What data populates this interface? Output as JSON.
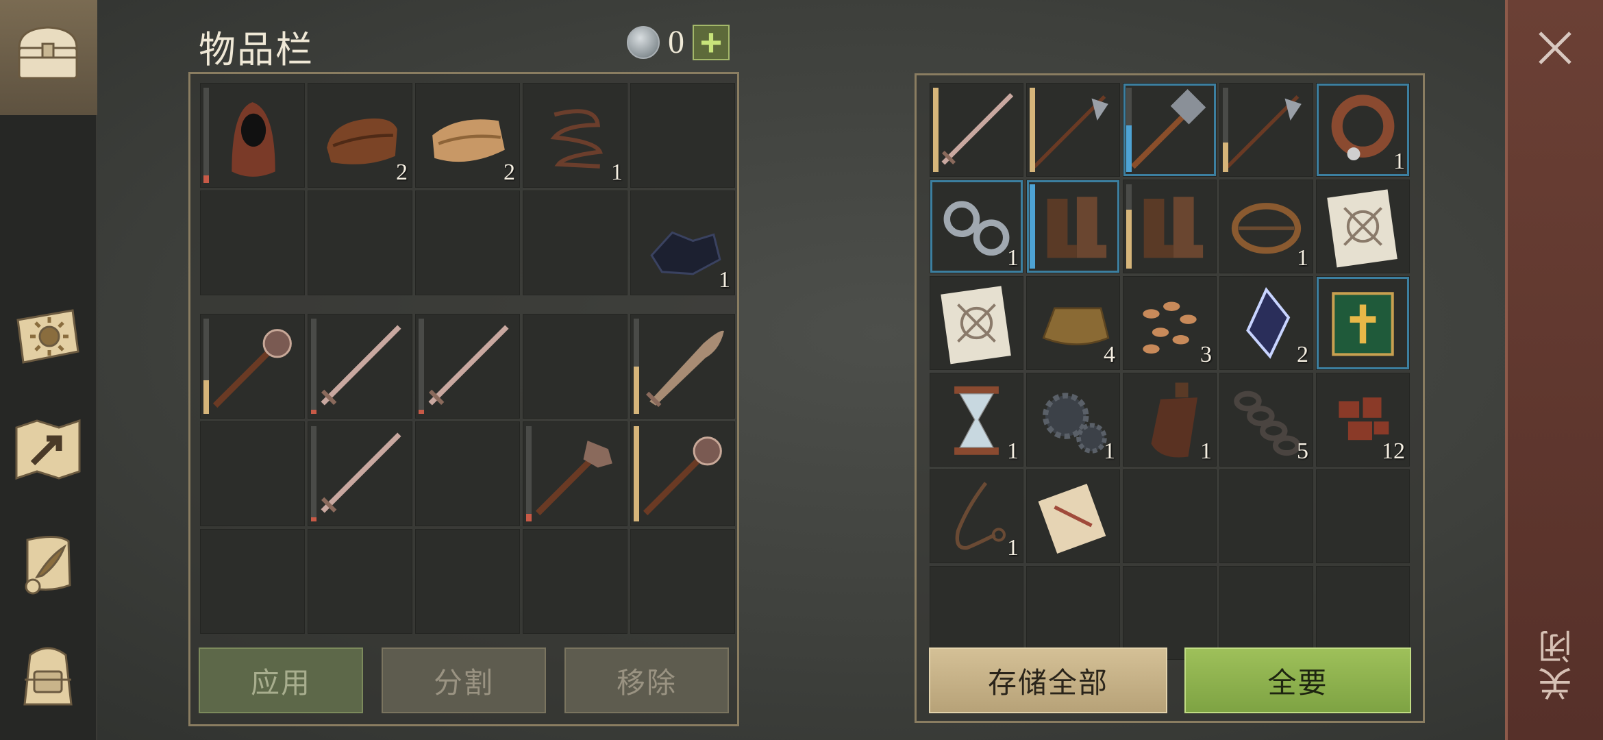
{
  "inventory": {
    "title": "物品栏",
    "currency": {
      "amount": "0",
      "add_label": "+"
    },
    "bag_slots": [
      {
        "icon": "hood-icon",
        "count": "",
        "durability": 0.08,
        "dur_color": "low"
      },
      {
        "icon": "leather-icon",
        "count": "2"
      },
      {
        "icon": "cloth-icon",
        "count": "2"
      },
      {
        "icon": "rope-icon",
        "count": "1"
      },
      {
        "icon": "empty",
        "count": ""
      },
      {
        "icon": "empty",
        "count": ""
      },
      {
        "icon": "empty",
        "count": ""
      },
      {
        "icon": "empty",
        "count": ""
      },
      {
        "icon": "empty",
        "count": ""
      },
      {
        "icon": "coal-icon",
        "count": "1"
      }
    ],
    "weapon_slots": [
      {
        "icon": "mace-icon",
        "count": "",
        "durability": 0.35
      },
      {
        "icon": "sword-icon",
        "count": "",
        "durability": 0.04,
        "dur_color": "low"
      },
      {
        "icon": "sword-icon",
        "count": "",
        "durability": 0.04,
        "dur_color": "low"
      },
      {
        "icon": "empty",
        "count": ""
      },
      {
        "icon": "falchion-icon",
        "count": "",
        "durability": 0.5
      },
      {
        "icon": "empty",
        "count": ""
      },
      {
        "icon": "sword-icon",
        "count": "",
        "durability": 0.04,
        "dur_color": "low"
      },
      {
        "icon": "empty",
        "count": ""
      },
      {
        "icon": "spiked-club-icon",
        "count": "",
        "durability": 0.08,
        "dur_color": "low"
      },
      {
        "icon": "mace-icon",
        "count": "",
        "durability": 1.0
      },
      {
        "icon": "empty",
        "count": ""
      },
      {
        "icon": "empty",
        "count": ""
      },
      {
        "icon": "empty",
        "count": ""
      },
      {
        "icon": "empty",
        "count": ""
      },
      {
        "icon": "empty",
        "count": ""
      }
    ],
    "buttons": {
      "apply": "应用",
      "split": "分割",
      "remove": "移除"
    }
  },
  "storage": {
    "slots": [
      {
        "icon": "sword-icon",
        "count": "",
        "durability": 1.0
      },
      {
        "icon": "halberd-icon",
        "count": "",
        "durability": 1.0
      },
      {
        "icon": "hammer-icon",
        "count": "",
        "durability": 0.55,
        "dur_color": "blue",
        "rare": true
      },
      {
        "icon": "halberd-icon",
        "count": "",
        "durability": 0.35
      },
      {
        "icon": "collar-icon",
        "count": "1",
        "rare": true
      },
      {
        "icon": "shackles-icon",
        "count": "1",
        "rare": true
      },
      {
        "icon": "boots-icon",
        "count": "",
        "durability": 1.0,
        "dur_color": "blue",
        "rare": true
      },
      {
        "icon": "boots-icon",
        "count": "",
        "durability": 0.7
      },
      {
        "icon": "bear-trap-icon",
        "count": "1"
      },
      {
        "icon": "blueprint-icon",
        "count": ""
      },
      {
        "icon": "blueprint-icon",
        "count": ""
      },
      {
        "icon": "ingot-icon",
        "count": "4"
      },
      {
        "icon": "seeds-icon",
        "count": "3"
      },
      {
        "icon": "crystal-icon",
        "count": "2"
      },
      {
        "icon": "book-icon",
        "count": "",
        "rare": true
      },
      {
        "icon": "hourglass-icon",
        "count": "1"
      },
      {
        "icon": "gears-icon",
        "count": "1"
      },
      {
        "icon": "flask-icon",
        "count": "1"
      },
      {
        "icon": "chain-icon",
        "count": "5"
      },
      {
        "icon": "scrap-icon",
        "count": "12"
      },
      {
        "icon": "lasso-icon",
        "count": "1"
      },
      {
        "icon": "scroll-icon",
        "count": ""
      },
      {
        "icon": "empty",
        "count": ""
      },
      {
        "icon": "empty",
        "count": ""
      },
      {
        "icon": "empty",
        "count": ""
      },
      {
        "icon": "empty",
        "count": ""
      },
      {
        "icon": "empty",
        "count": ""
      },
      {
        "icon": "empty",
        "count": ""
      },
      {
        "icon": "empty",
        "count": ""
      },
      {
        "icon": "empty",
        "count": ""
      }
    ],
    "buttons": {
      "store_all": "存储全部",
      "take_all": "全要"
    }
  },
  "sidebar": {
    "items": [
      "chest-icon",
      "sun-book-icon",
      "map-icon",
      "quest-scroll-icon",
      "backpack-icon"
    ]
  },
  "close": {
    "label": "关闭"
  },
  "colors": {
    "accent_green": "#8db04e",
    "rare_border": "#3c7fa0",
    "panel_border": "#8a7d61",
    "close_strip": "#5e352c"
  }
}
